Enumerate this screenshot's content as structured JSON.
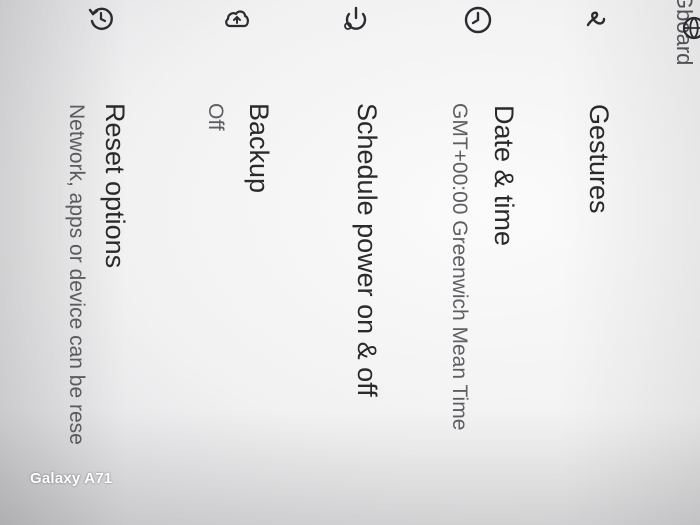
{
  "settings": {
    "items": [
      {
        "title": "Gboard",
        "subtitle": ""
      },
      {
        "title": "Gestures",
        "subtitle": ""
      },
      {
        "title": "Date & time",
        "subtitle": "GMT+00:00 Greenwich Mean Time"
      },
      {
        "title": "Schedule power on & off",
        "subtitle": ""
      },
      {
        "title": "Backup",
        "subtitle": "Off"
      },
      {
        "title": "Reset options",
        "subtitle": "Network, apps or device can be rese"
      }
    ],
    "icons": [
      "globe-icon",
      "gesture-icon",
      "clock-icon",
      "power-schedule-icon",
      "cloud-backup-icon",
      "reset-icon"
    ]
  },
  "watermark": {
    "text": "Galaxy A71"
  },
  "colors": {
    "text": "#2a2a2c",
    "subtext": "#5f5f63",
    "icon": "#2c2c30"
  }
}
